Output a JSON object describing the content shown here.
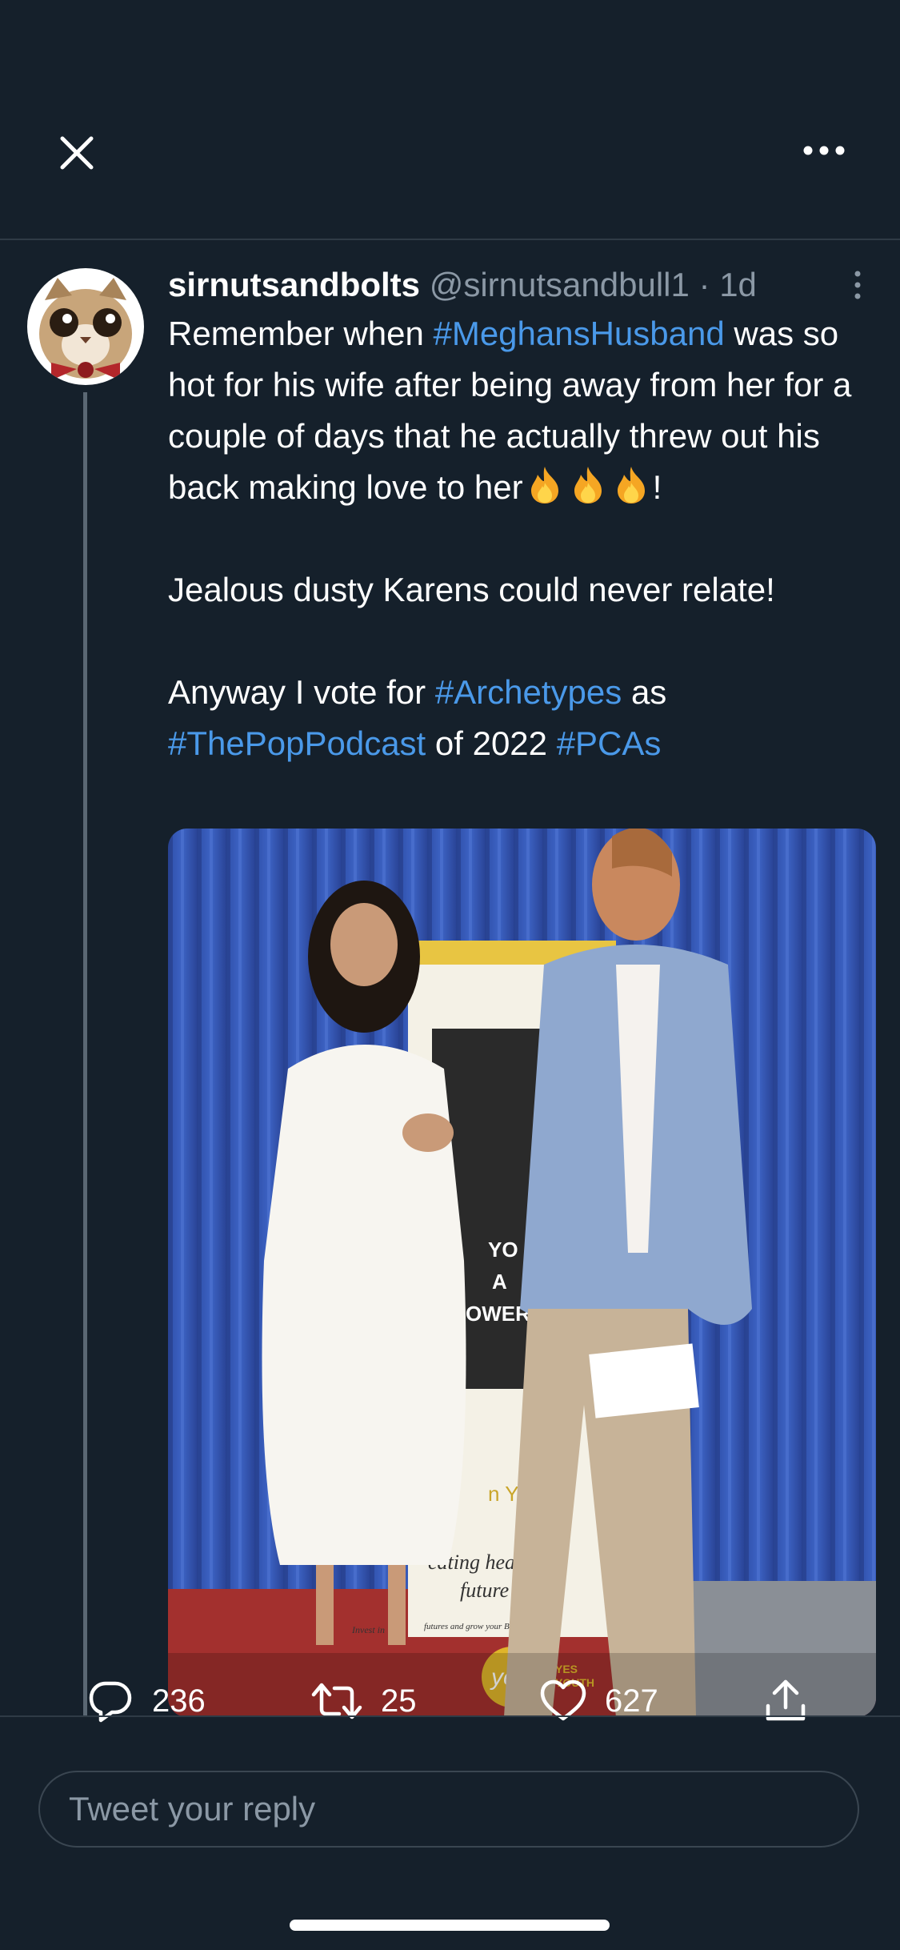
{
  "header": {
    "close_icon": "close-icon",
    "more_icon": "more-horizontal-icon"
  },
  "tweet": {
    "author": "sirnutsandbolts",
    "handle": "@sirnutsandbull1",
    "separator": "·",
    "time": "1d",
    "text": {
      "p1_a": "Remember when ",
      "p1_tag": "#MeghansHusband",
      "p1_b": " was so hot for his wife after being away from her for a couple of days that he actually threw out his back making love to her",
      "p1_end": "!",
      "p2": "Jealous dusty Karens could never relate!",
      "p3_a": "Anyway I vote for ",
      "p3_tag1": "#Archetypes",
      "p3_b": " as ",
      "p3_tag2": "#ThePopPodcast",
      "p3_c": " of 2022 ",
      "p3_tag3": "#PCAs"
    },
    "photo_sign": {
      "line1": "YO",
      "line2": "A",
      "line3": "OWERF",
      "line4": "n YO",
      "line5": "eating heart",
      "line6": "future",
      "line7": "Invest in",
      "line8": "futures and grow your B-BBEE sco",
      "logo_yes": "yes",
      "logo_yes2": "YES",
      "logo_youth": "YOUTH"
    }
  },
  "actions": {
    "replies": "236",
    "retweets": "25",
    "likes": "627"
  },
  "reply": {
    "placeholder": "Tweet your reply"
  },
  "colors": {
    "background": "#15202b",
    "hashtag": "#4a99e9",
    "muted": "#8b98a5",
    "divider": "#2f3b46"
  }
}
